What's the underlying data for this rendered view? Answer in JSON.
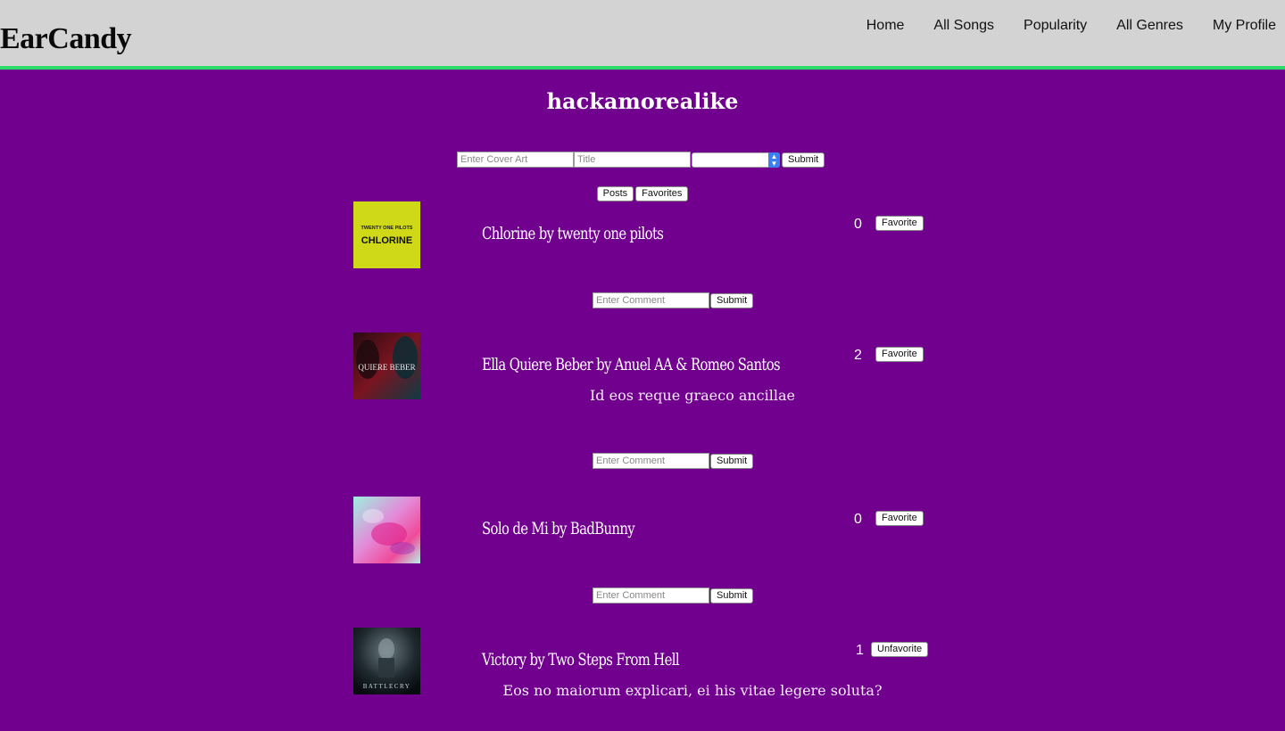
{
  "brand": "EarCandy",
  "nav": {
    "home": "Home",
    "all_songs": "All Songs",
    "popularity": "Popularity",
    "all_genres": "All Genres",
    "my_profile": "My Profile"
  },
  "profile": {
    "username": "hackamorealike"
  },
  "post_form": {
    "cover_placeholder": "Enter Cover Art",
    "title_placeholder": "Title",
    "genre_value": "",
    "submit_label": "Submit"
  },
  "view_toggle": {
    "posts_label": "Posts",
    "favorites_label": "Favorites"
  },
  "comment_form": {
    "placeholder": "Enter Comment",
    "submit_label": "Submit"
  },
  "posts": [
    {
      "title": "Chlorine by twenty one pilots",
      "favorites": "0",
      "fav_label": "Favorite",
      "comment": "",
      "cover_text_top": "TWENTY ONE PILOTS",
      "cover_text_main": "CHLORINE",
      "cover_color": "#d9e21c"
    },
    {
      "title": "Ella Quiere Beber by Anuel AA & Romeo Santos",
      "favorites": "2",
      "fav_label": "Favorite",
      "comment": "Id eos reque graeco ancillae",
      "cover_text_main": "QUIERE BEBER"
    },
    {
      "title": "Solo de Mi by BadBunny",
      "favorites": "0",
      "fav_label": "Favorite",
      "comment": ""
    },
    {
      "title": "Victory by Two Steps From Hell",
      "favorites": "1",
      "fav_label": "Unfavorite",
      "comment": "Eos no maiorum explicari, ei his vitae legere soluta?",
      "cover_text_main": "BATTLECRY"
    }
  ]
}
